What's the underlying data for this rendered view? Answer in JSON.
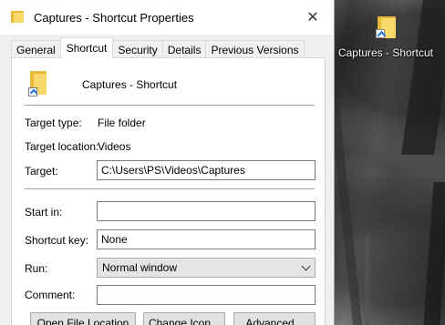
{
  "window": {
    "title": "Captures - Shortcut Properties",
    "close_glyph": "✕"
  },
  "tabs": [
    {
      "label": "General",
      "active": false
    },
    {
      "label": "Shortcut",
      "active": true
    },
    {
      "label": "Security",
      "active": false
    },
    {
      "label": "Details",
      "active": false
    },
    {
      "label": "Previous Versions",
      "active": false
    }
  ],
  "shortcut": {
    "name": "Captures - Shortcut",
    "target_type_label": "Target type:",
    "target_type_value": "File folder",
    "target_location_label": "Target location:",
    "target_location_value": "Videos",
    "target_label": "Target:",
    "target_value": "C:\\Users\\PS\\Videos\\Captures",
    "start_in_label": "Start in:",
    "start_in_value": "",
    "shortcut_key_label": "Shortcut key:",
    "shortcut_key_value": "None",
    "run_label": "Run:",
    "run_value": "Normal window",
    "comment_label": "Comment:",
    "comment_value": ""
  },
  "buttons": {
    "open_file_location": "Open File Location",
    "change_icon": "Change Icon...",
    "advanced": "Advanced..."
  },
  "desktop": {
    "icon_label": "Captures - Shortcut"
  },
  "colors": {
    "folder_back": "#e8b93a",
    "folder_front": "#f7d86b",
    "shortcut_arrow": "#1e6fd9"
  }
}
